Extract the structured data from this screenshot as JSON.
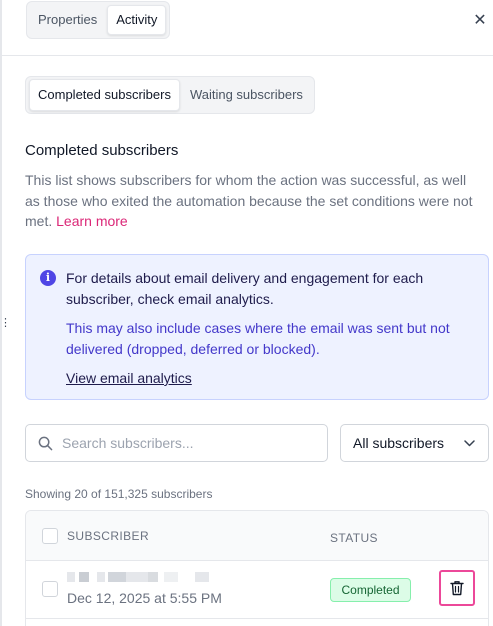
{
  "tabs": [
    {
      "label": "Properties",
      "active": false
    },
    {
      "label": "Activity",
      "active": true
    }
  ],
  "close_icon": "x-close-icon",
  "left_rail_mark": "⋮",
  "subtabs": [
    {
      "label": "Completed subscribers",
      "active": true
    },
    {
      "label": "Waiting subscribers",
      "active": false
    }
  ],
  "section": {
    "title": "Completed subscribers",
    "description": "This list shows subscribers for whom the action was successful, as well as those who exited the automation because the set conditions were not met.",
    "learn_more": "Learn more"
  },
  "info": {
    "icon": "info-circle-icon",
    "p1": "For details about email delivery and engagement for each subscriber, check email analytics.",
    "p2": "This may also include cases where the email was sent but not delivered (dropped, deferred or blocked).",
    "link": "View email analytics"
  },
  "search": {
    "placeholder": "Search subscribers...",
    "value": ""
  },
  "filter": {
    "selected": "All subscribers"
  },
  "count_text": "Showing 20 of 151,325 subscribers",
  "table": {
    "columns": {
      "subscriber": "SUBSCRIBER",
      "status": "STATUS"
    },
    "rows": [
      {
        "email": "(redacted)",
        "date": "Dec 12, 2025 at 5:55 PM",
        "status": "Completed"
      }
    ]
  },
  "colors": {
    "accent_pink": "#db2777",
    "info_bg": "#eef2ff",
    "info_icon": "#4f46e5",
    "status_green_bg": "#dcfce7",
    "status_green_text": "#166534",
    "highlight_border": "#ec4899"
  }
}
